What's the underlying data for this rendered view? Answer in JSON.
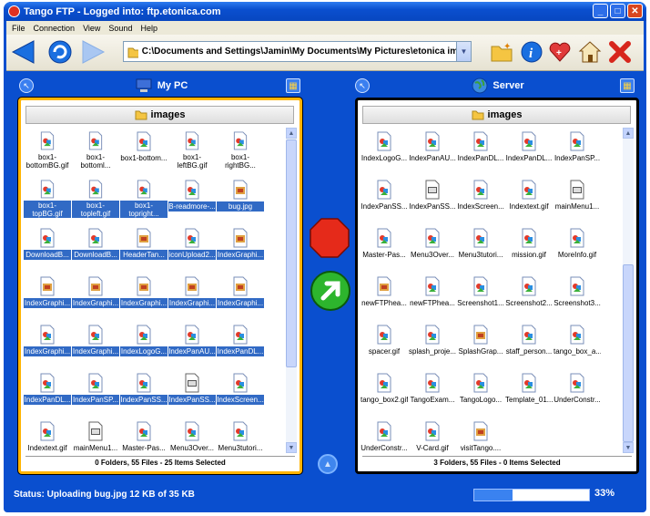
{
  "window": {
    "title": "Tango FTP - Logged into: ftp.etonica.com"
  },
  "menu": [
    "File",
    "Connection",
    "View",
    "Sound",
    "Help"
  ],
  "toolbar": {
    "path": "C:\\Documents and Settings\\Jamin\\My Documents\\My Pictures\\etonica ima..."
  },
  "left": {
    "title": "My PC",
    "folder": "images",
    "status": "0 Folders, 55 Files - 25 Items Selected",
    "files": [
      {
        "name": "box1-bottomBG.gif",
        "sel": false,
        "type": "gif"
      },
      {
        "name": "box1-bottoml...",
        "sel": false,
        "type": "gif"
      },
      {
        "name": "box1-bottom...",
        "sel": false,
        "type": "gif"
      },
      {
        "name": "box1-leftBG.gif",
        "sel": false,
        "type": "gif"
      },
      {
        "name": "box1-rightBG...",
        "sel": false,
        "type": "gif"
      },
      {
        "name": "box1-topBG.gif",
        "sel": true,
        "type": "gif"
      },
      {
        "name": "box1-topleft.gif",
        "sel": true,
        "type": "gif"
      },
      {
        "name": "box1-topright...",
        "sel": true,
        "type": "gif"
      },
      {
        "name": "B-readmore-...",
        "sel": true,
        "type": "gif"
      },
      {
        "name": "bug.jpg",
        "sel": true,
        "type": "jpg"
      },
      {
        "name": "DownloadB...",
        "sel": true,
        "type": "gif"
      },
      {
        "name": "DownloadB...",
        "sel": true,
        "type": "gif"
      },
      {
        "name": "HeaderTan...",
        "sel": true,
        "type": "jpg"
      },
      {
        "name": "iconUpload2...",
        "sel": true,
        "type": "gif"
      },
      {
        "name": "IndexGraphi...",
        "sel": true,
        "type": "jpg"
      },
      {
        "name": "IndexGraphi...",
        "sel": true,
        "type": "jpg"
      },
      {
        "name": "IndexGraphi...",
        "sel": true,
        "type": "jpg"
      },
      {
        "name": "IndexGraphi...",
        "sel": true,
        "type": "jpg"
      },
      {
        "name": "IndexGraphi...",
        "sel": true,
        "type": "jpg"
      },
      {
        "name": "IndexGraphi...",
        "sel": true,
        "type": "jpg"
      },
      {
        "name": "IndexGraphi...",
        "sel": true,
        "type": "gif"
      },
      {
        "name": "IndexGraphi...",
        "sel": true,
        "type": "gif"
      },
      {
        "name": "IndexLogoG...",
        "sel": true,
        "type": "gif"
      },
      {
        "name": "IndexPanAU...",
        "sel": true,
        "type": "gif"
      },
      {
        "name": "IndexPanDL...",
        "sel": true,
        "type": "gif"
      },
      {
        "name": "IndexPanDL...",
        "sel": true,
        "type": "gif"
      },
      {
        "name": "IndexPanSP...",
        "sel": true,
        "type": "gif"
      },
      {
        "name": "IndexPanSS...",
        "sel": true,
        "type": "gif"
      },
      {
        "name": "IndexPanSS...",
        "sel": true,
        "type": "doc"
      },
      {
        "name": "IndexScreen...",
        "sel": true,
        "type": "gif"
      },
      {
        "name": "Indextext.gif",
        "sel": false,
        "type": "gif"
      },
      {
        "name": "mainMenu1...",
        "sel": false,
        "type": "doc"
      },
      {
        "name": "Master-Pas...",
        "sel": false,
        "type": "gif"
      },
      {
        "name": "Menu3Over...",
        "sel": false,
        "type": "gif"
      },
      {
        "name": "Menu3tutori...",
        "sel": false,
        "type": "gif"
      }
    ]
  },
  "right": {
    "title": "Server",
    "folder": "images",
    "status": "3 Folders, 55 Files - 0 Items Selected",
    "files": [
      {
        "name": "IndexLogoG...",
        "sel": false,
        "type": "gif"
      },
      {
        "name": "IndexPanAU...",
        "sel": false,
        "type": "gif"
      },
      {
        "name": "IndexPanDL...",
        "sel": false,
        "type": "gif"
      },
      {
        "name": "IndexPanDL...",
        "sel": false,
        "type": "gif"
      },
      {
        "name": "IndexPanSP...",
        "sel": false,
        "type": "gif"
      },
      {
        "name": "IndexPanSS...",
        "sel": false,
        "type": "gif"
      },
      {
        "name": "IndexPanSS...",
        "sel": false,
        "type": "doc"
      },
      {
        "name": "IndexScreen...",
        "sel": false,
        "type": "gif"
      },
      {
        "name": "Indextext.gif",
        "sel": false,
        "type": "gif"
      },
      {
        "name": "mainMenu1...",
        "sel": false,
        "type": "doc"
      },
      {
        "name": "Master-Pas...",
        "sel": false,
        "type": "gif"
      },
      {
        "name": "Menu3Over...",
        "sel": false,
        "type": "gif"
      },
      {
        "name": "Menu3tutori...",
        "sel": false,
        "type": "gif"
      },
      {
        "name": "mission.gif",
        "sel": false,
        "type": "gif"
      },
      {
        "name": "MoreInfo.gif",
        "sel": false,
        "type": "gif"
      },
      {
        "name": "newFTPhea...",
        "sel": false,
        "type": "jpg"
      },
      {
        "name": "newFTPhea...",
        "sel": false,
        "type": "gif"
      },
      {
        "name": "Screenshot1...",
        "sel": false,
        "type": "gif"
      },
      {
        "name": "Screenshot2...",
        "sel": false,
        "type": "gif"
      },
      {
        "name": "Screenshot3...",
        "sel": false,
        "type": "gif"
      },
      {
        "name": "spacer.gif",
        "sel": false,
        "type": "gif"
      },
      {
        "name": "splash_proje...",
        "sel": false,
        "type": "gif"
      },
      {
        "name": "SplashGrap...",
        "sel": false,
        "type": "jpg"
      },
      {
        "name": "staff_person...",
        "sel": false,
        "type": "gif"
      },
      {
        "name": "tango_box_a...",
        "sel": false,
        "type": "gif"
      },
      {
        "name": "tango_box2.gif",
        "sel": false,
        "type": "gif"
      },
      {
        "name": "TangoExam...",
        "sel": false,
        "type": "gif"
      },
      {
        "name": "TangoLogo...",
        "sel": false,
        "type": "gif"
      },
      {
        "name": "Template_01...",
        "sel": false,
        "type": "gif"
      },
      {
        "name": "UnderConstr...",
        "sel": false,
        "type": "gif"
      },
      {
        "name": "UnderConstr...",
        "sel": false,
        "type": "gif"
      },
      {
        "name": "V-Card.gif",
        "sel": false,
        "type": "gif"
      },
      {
        "name": "visitTango....",
        "sel": false,
        "type": "jpg"
      }
    ]
  },
  "statusbar": {
    "text": "Status: Uploading bug.jpg 12 KB of 35 KB",
    "progress_percent": 33,
    "progress_label": "33%"
  },
  "colors": {
    "selection": "#316ac5",
    "window_blue": "#0a4fcf",
    "active_border": "#ffb400"
  }
}
